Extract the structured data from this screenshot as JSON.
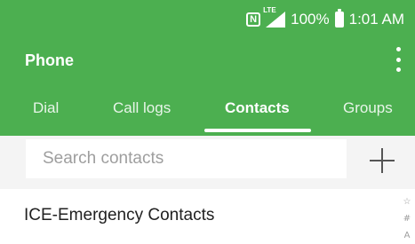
{
  "status_bar": {
    "nfc_icon": "nfc-icon",
    "network_label": "LTE",
    "battery_percent": "100%",
    "time": "1:01 AM"
  },
  "app_bar": {
    "title": "Phone",
    "menu_icon": "more-vert-icon"
  },
  "tabs": [
    {
      "label": "Dial",
      "active": false
    },
    {
      "label": "Call logs",
      "active": false
    },
    {
      "label": "Contacts",
      "active": true
    },
    {
      "label": "Groups",
      "active": false
    }
  ],
  "search": {
    "placeholder": "Search contacts",
    "value": "",
    "add_icon": "plus-icon"
  },
  "contacts": {
    "items": [
      {
        "label": "ICE-Emergency Contacts"
      }
    ]
  },
  "index_bar": {
    "items": [
      "☆",
      "#",
      "A"
    ]
  },
  "colors": {
    "header": "#4caf50",
    "search_background": "#f4f4f4",
    "tab_indicator": "#ffffff"
  }
}
